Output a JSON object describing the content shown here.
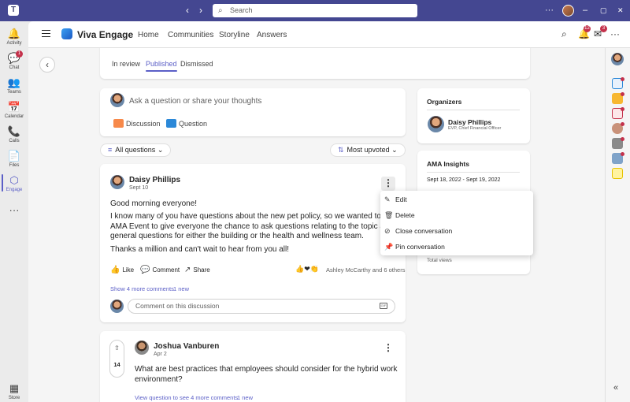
{
  "titlebar": {
    "search_placeholder": "Search",
    "logo_text": "T",
    "back_arrow": "‹",
    "forward_arrow": "›",
    "more": "···",
    "minimize": "–",
    "maximize": "▢",
    "close": "✕"
  },
  "rail": {
    "items": [
      {
        "label": "Activity",
        "icon": "🔔"
      },
      {
        "label": "Chat",
        "icon": "💬",
        "badge": "1"
      },
      {
        "label": "Teams",
        "icon": "👥"
      },
      {
        "label": "Calendar",
        "icon": "📅"
      },
      {
        "label": "Calls",
        "icon": "📞"
      },
      {
        "label": "Files",
        "icon": "📄"
      },
      {
        "label": "Engage",
        "icon": "⬡"
      },
      {
        "label": "",
        "icon": "···"
      },
      {
        "label": "Store",
        "icon": "▦"
      }
    ]
  },
  "header": {
    "app_name": "Viva Engage",
    "nav": [
      "Home",
      "Communities",
      "Storyline",
      "Answers"
    ],
    "notif_badge": "12",
    "inbox_badge": "3",
    "more": "···"
  },
  "tabs": [
    "In review",
    "Published",
    "Dismissed"
  ],
  "composer": {
    "placeholder": "Ask a question or share your thoughts",
    "discussion_label": "Discussion",
    "question_label": "Question"
  },
  "filters": {
    "left": "All questions",
    "right": "Most upvoted"
  },
  "post": {
    "author": "Daisy Phillips",
    "date": "Sept 10",
    "lines": [
      "Good morning everyone!",
      "I know many of you have questions about the new pet policy, so we wanted to set up an",
      "AMA Event to give everyone the chance to ask questions relating to the topic as well as",
      "general questions for either the building or the health and wellness team.",
      "Thanks a million and can't wait to hear from you all!"
    ],
    "like_label": "Like",
    "comment_label": "Comment",
    "share_label": "Share",
    "reactions_text": "Ashley McCarthy and 6 others",
    "show_comments": "Show 4 more comments",
    "new_count": "1 new",
    "comment_placeholder": "Comment on this discussion"
  },
  "question": {
    "author": "Joshua Vanburen",
    "date": "Apr 2",
    "votes": "14",
    "lines": [
      "What are best practices that employees should consider for the hybrid work",
      "environment?"
    ],
    "view_link": "View question to see 4 more comments",
    "new_count": "1 new"
  },
  "organizers": {
    "title": "Organizers",
    "name": "Daisy Phillips",
    "role": "EVP, Chief Financial Officer"
  },
  "insights": {
    "title": "AMA Insights",
    "date_range": "Sept 18, 2022 - Sept 19, 2022",
    "views_label": "Total views"
  },
  "menu": {
    "items": [
      {
        "label": "Edit",
        "icon": "✎"
      },
      {
        "label": "Delete",
        "icon": "🗑"
      },
      {
        "label": "Close conversation",
        "icon": "⊘"
      },
      {
        "label": "Pin conversation",
        "icon": "📌"
      }
    ]
  },
  "colors": {
    "titlebar": "#444791",
    "accent": "#5b5fc7",
    "badge": "#c4314b"
  }
}
